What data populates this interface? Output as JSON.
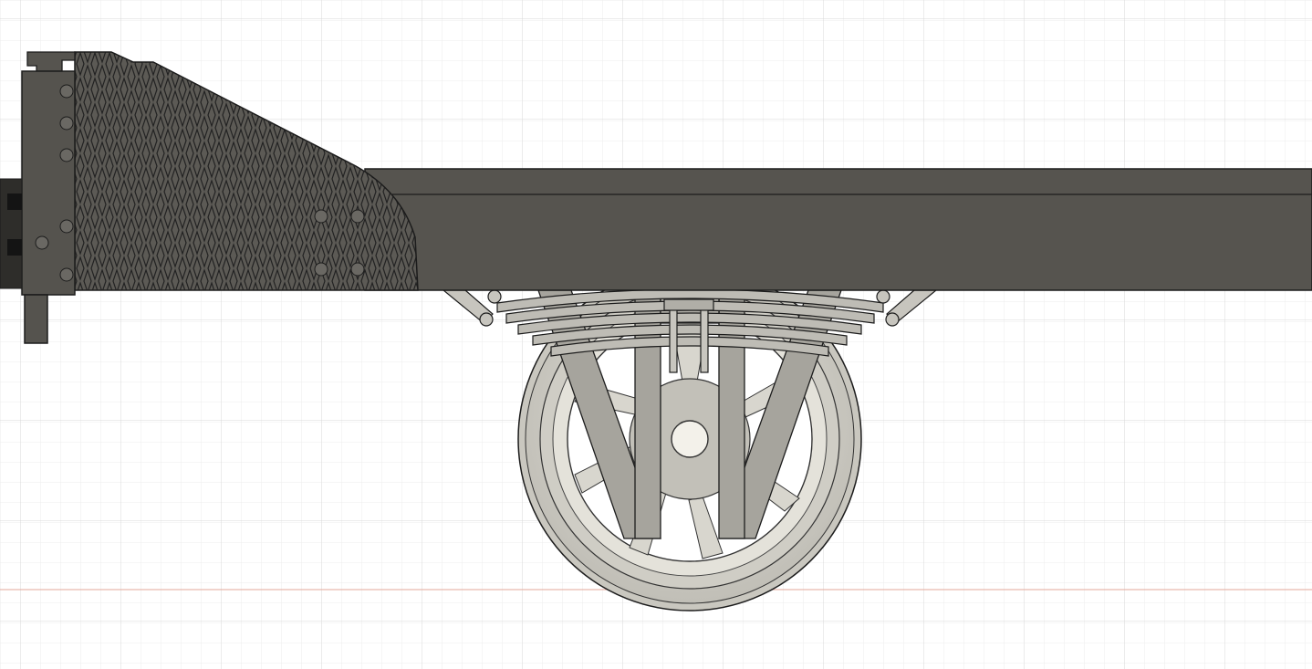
{
  "viewport": {
    "view": "side",
    "grid": true
  },
  "colors": {
    "background": "#ffffff",
    "grid_minor": "#ececec",
    "grid_major": "#d9d9d9",
    "ground_plane_line": "#e3a79a",
    "frame_body": "#56544f",
    "frame_outline": "#1c1c1c",
    "checker_plate": "#5c5a55",
    "wheel_fill": "#d4d2cb",
    "suspension_fill": "#a6a49d"
  },
  "model": {
    "parts": [
      "frame-rail",
      "checker-plate-end",
      "end-plate",
      "leaf-spring",
      "axle-hanger",
      "spoked-wheel"
    ]
  }
}
